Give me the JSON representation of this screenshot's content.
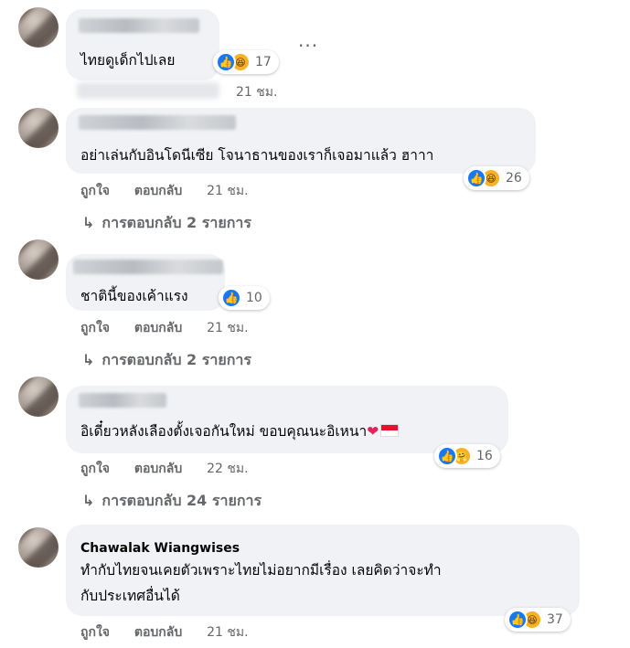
{
  "comments": [
    {
      "author": "",
      "text": "ไทยดูเด็กไปเลย",
      "reactions": {
        "types": [
          "like-icon",
          "haha-icon"
        ],
        "count": "17"
      },
      "time": "21 ชม.",
      "more": "..."
    },
    {
      "author": "",
      "text": "อย่าเล่นกับอินโดนีเซีย โจนาธานของเราก็เจอมาแล้ว ฮาาา",
      "reactions": {
        "types": [
          "like-icon",
          "haha-icon"
        ],
        "count": "26"
      },
      "like": "ถูกใจ",
      "reply": "ตอบกลับ",
      "time": "21 ชม.",
      "replies": "การตอบกลับ 2 รายการ"
    },
    {
      "author": "",
      "text": "ชาตินี้ของเค้าแรง",
      "reactions": {
        "types": [
          "like-icon"
        ],
        "count": "10"
      },
      "like": "ถูกใจ",
      "reply": "ตอบกลับ",
      "time": "21 ชม.",
      "replies": "การตอบกลับ 2 รายการ"
    },
    {
      "author": "",
      "text": "อิเดี๋ยวหลังเลืองตั้งเจอกันใหม่ ขอบคุณนะอิเหนา",
      "reactions": {
        "types": [
          "like-icon",
          "care-icon"
        ],
        "count": "16"
      },
      "like": "ถูกใจ",
      "reply": "ตอบกลับ",
      "time": "22 ชม.",
      "replies": "การตอบกลับ 24 รายการ"
    },
    {
      "author": "Chawalak Wiangwises",
      "text_line1": "ทำกับไทยจนเคยตัวเพราะไทยไม่อยากมีเรื่อง เลยคิดว่าจะทำ",
      "text_line2": "กับประเทศอื่นได้",
      "reactions": {
        "types": [
          "like-icon",
          "haha-icon"
        ],
        "count": "37"
      },
      "like": "ถูกใจ",
      "reply": "ตอบกลับ",
      "time": "21 ชม."
    }
  ],
  "colors": {
    "bubble": "#f0f2f5",
    "meta": "#65676b",
    "like": "#1877f2",
    "haha": "#f7b125"
  }
}
